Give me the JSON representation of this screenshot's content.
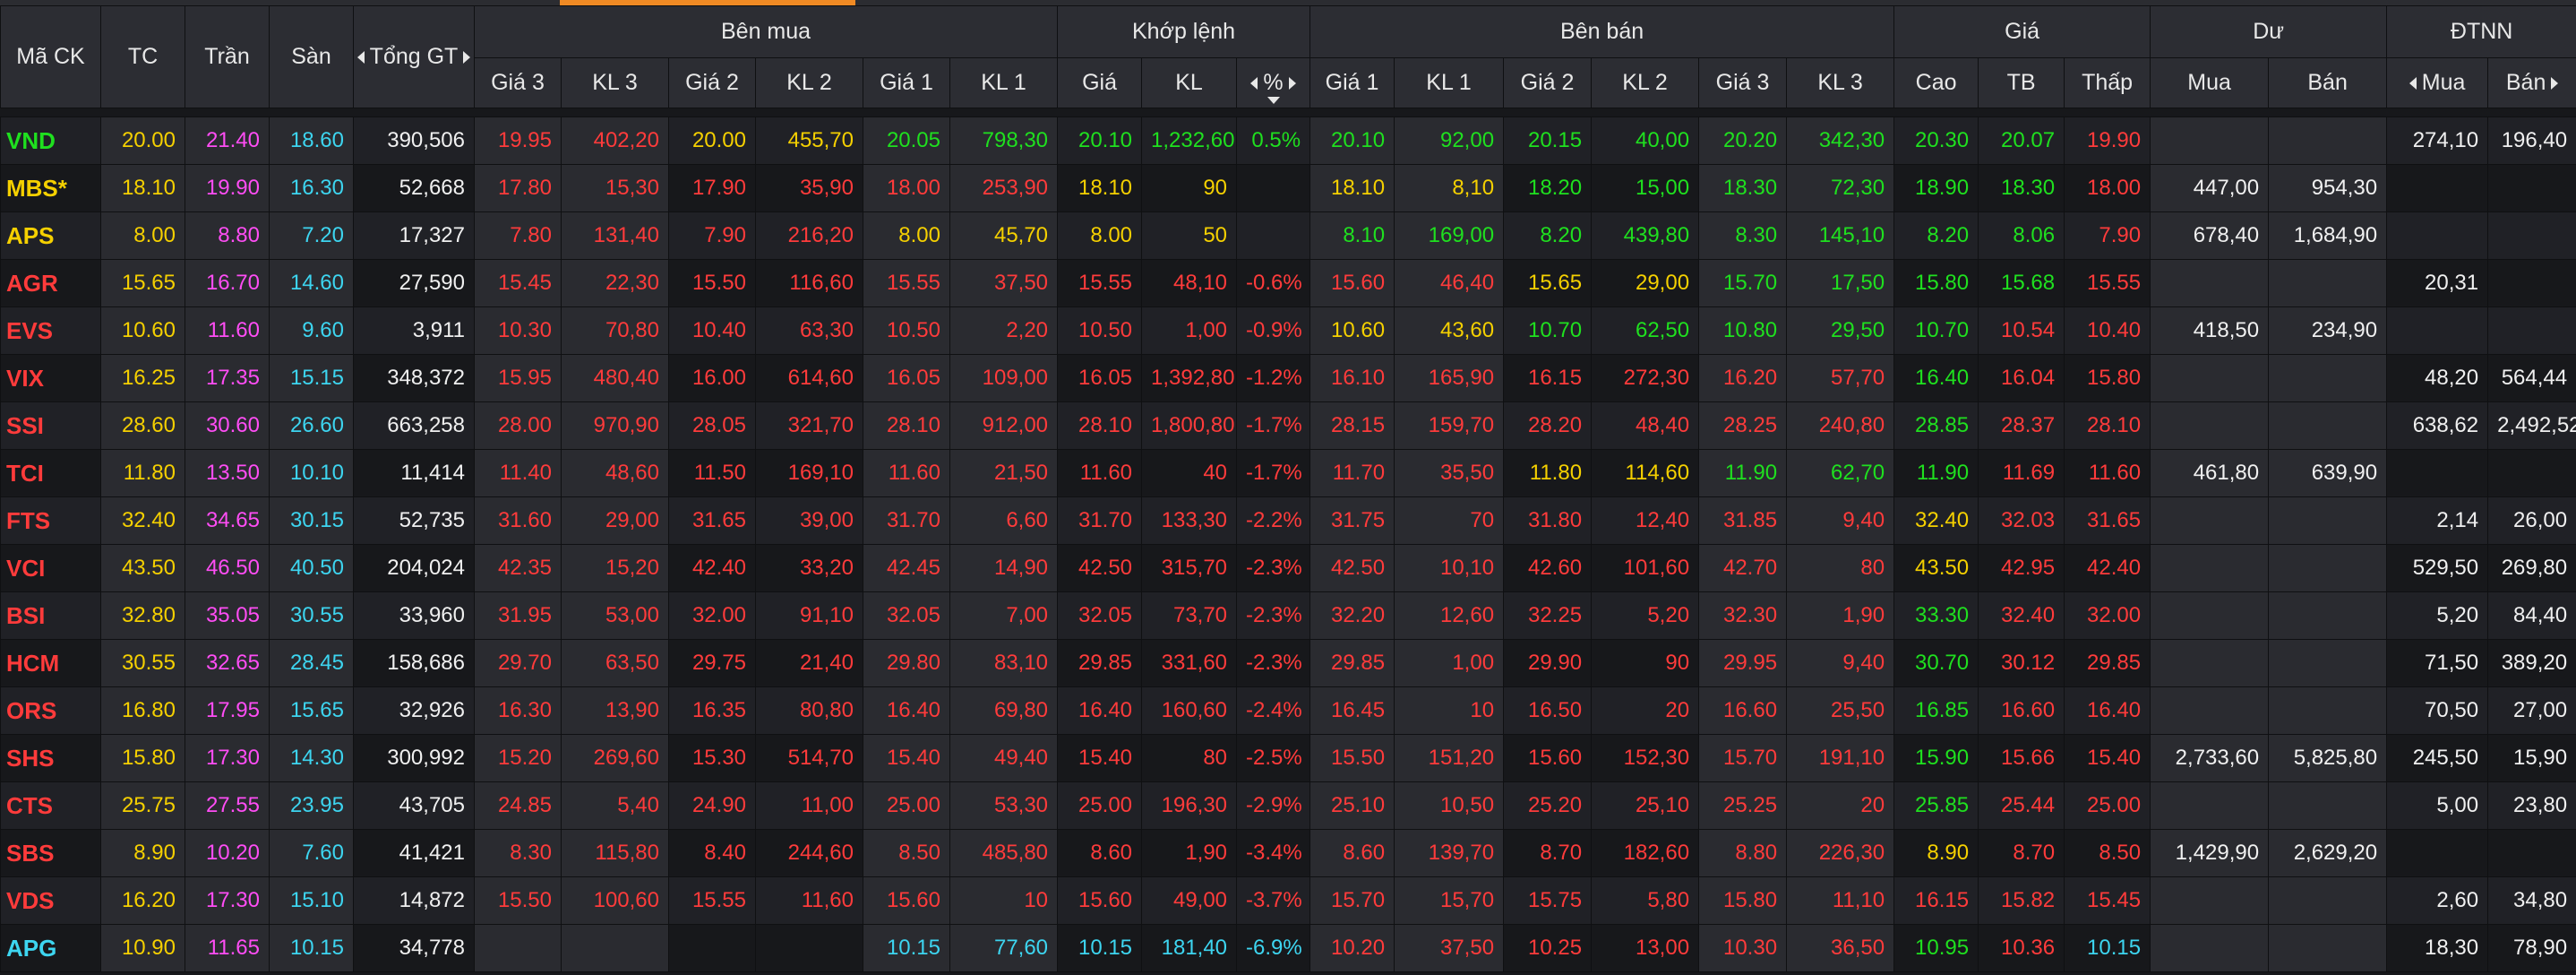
{
  "header": {
    "symbol": "Mã CK",
    "ref": "TC",
    "ceil": "Trần",
    "floor": "Sàn",
    "total": "Tổng GT",
    "groups": {
      "buy": "Bên mua",
      "match": "Khớp lệnh",
      "sell": "Bên bán",
      "price": "Giá",
      "remain": "Dư",
      "foreign": "ĐTNN"
    },
    "buy_cols": [
      "Giá 3",
      "KL 3",
      "Giá 2",
      "KL 2",
      "Giá 1",
      "KL 1"
    ],
    "match_cols": [
      "Giá",
      "KL",
      "%"
    ],
    "sell_cols": [
      "Giá 1",
      "KL 1",
      "Giá 2",
      "KL 2",
      "Giá 3",
      "KL 3"
    ],
    "price_cols": [
      "Cao",
      "TB",
      "Thấp"
    ],
    "remain_cols": [
      "Mua",
      "Bán"
    ],
    "foreign_cols": [
      "Mua",
      "Bán"
    ]
  },
  "colors": {
    "reference": "#f5d000",
    "ceiling": "#ff4df5",
    "floor": "#3dd5f0",
    "up": "#1fe01f",
    "down": "#ff3b3b",
    "neutral": "#f0f0f0"
  },
  "rows": [
    {
      "sym": "VND",
      "tc": "20.00",
      "tran": "21.40",
      "san": "18.60",
      "tong": "390,506",
      "g3": "19.95",
      "kl3": "402,20",
      "g2": "20.00",
      "kl2": "455,70",
      "g1": "20.05",
      "kl1": "798,30",
      "mg": "20.10",
      "mkl": "1,232,60",
      "pct": "0.5%",
      "sg1": "20.10",
      "skl1": "92,00",
      "sg2": "20.15",
      "skl2": "40,00",
      "sg3": "20.20",
      "skl3": "342,30",
      "cao": "20.30",
      "tb": "20.07",
      "thap": "19.90",
      "dmua": "",
      "dban": "",
      "nmua": "274,10",
      "nban": "196,40"
    },
    {
      "sym": "MBS*",
      "tc": "18.10",
      "tran": "19.90",
      "san": "16.30",
      "tong": "52,668",
      "g3": "17.80",
      "kl3": "15,30",
      "g2": "17.90",
      "kl2": "35,90",
      "g1": "18.00",
      "kl1": "253,90",
      "mg": "18.10",
      "mkl": "90",
      "pct": "",
      "sg1": "18.10",
      "skl1": "8,10",
      "sg2": "18.20",
      "skl2": "15,00",
      "sg3": "18.30",
      "skl3": "72,30",
      "cao": "18.90",
      "tb": "18.30",
      "thap": "18.00",
      "dmua": "447,00",
      "dban": "954,30",
      "nmua": "",
      "nban": ""
    },
    {
      "sym": "APS",
      "tc": "8.00",
      "tran": "8.80",
      "san": "7.20",
      "tong": "17,327",
      "g3": "7.80",
      "kl3": "131,40",
      "g2": "7.90",
      "kl2": "216,20",
      "g1": "8.00",
      "kl1": "45,70",
      "mg": "8.00",
      "mkl": "50",
      "pct": "",
      "sg1": "8.10",
      "skl1": "169,00",
      "sg2": "8.20",
      "skl2": "439,80",
      "sg3": "8.30",
      "skl3": "145,10",
      "cao": "8.20",
      "tb": "8.06",
      "thap": "7.90",
      "dmua": "678,40",
      "dban": "1,684,90",
      "nmua": "",
      "nban": ""
    },
    {
      "sym": "AGR",
      "tc": "15.65",
      "tran": "16.70",
      "san": "14.60",
      "tong": "27,590",
      "g3": "15.45",
      "kl3": "22,30",
      "g2": "15.50",
      "kl2": "116,60",
      "g1": "15.55",
      "kl1": "37,50",
      "mg": "15.55",
      "mkl": "48,10",
      "pct": "-0.6%",
      "sg1": "15.60",
      "skl1": "46,40",
      "sg2": "15.65",
      "skl2": "29,00",
      "sg3": "15.70",
      "skl3": "17,50",
      "cao": "15.80",
      "tb": "15.68",
      "thap": "15.55",
      "dmua": "",
      "dban": "",
      "nmua": "20,31",
      "nban": ""
    },
    {
      "sym": "EVS",
      "tc": "10.60",
      "tran": "11.60",
      "san": "9.60",
      "tong": "3,911",
      "g3": "10.30",
      "kl3": "70,80",
      "g2": "10.40",
      "kl2": "63,30",
      "g1": "10.50",
      "kl1": "2,20",
      "mg": "10.50",
      "mkl": "1,00",
      "pct": "-0.9%",
      "sg1": "10.60",
      "skl1": "43,60",
      "sg2": "10.70",
      "skl2": "62,50",
      "sg3": "10.80",
      "skl3": "29,50",
      "cao": "10.70",
      "tb": "10.54",
      "thap": "10.40",
      "dmua": "418,50",
      "dban": "234,90",
      "nmua": "",
      "nban": ""
    },
    {
      "sym": "VIX",
      "tc": "16.25",
      "tran": "17.35",
      "san": "15.15",
      "tong": "348,372",
      "g3": "15.95",
      "kl3": "480,40",
      "g2": "16.00",
      "kl2": "614,60",
      "g1": "16.05",
      "kl1": "109,00",
      "mg": "16.05",
      "mkl": "1,392,80",
      "pct": "-1.2%",
      "sg1": "16.10",
      "skl1": "165,90",
      "sg2": "16.15",
      "skl2": "272,30",
      "sg3": "16.20",
      "skl3": "57,70",
      "cao": "16.40",
      "tb": "16.04",
      "thap": "15.80",
      "dmua": "",
      "dban": "",
      "nmua": "48,20",
      "nban": "564,44"
    },
    {
      "sym": "SSI",
      "tc": "28.60",
      "tran": "30.60",
      "san": "26.60",
      "tong": "663,258",
      "g3": "28.00",
      "kl3": "970,90",
      "g2": "28.05",
      "kl2": "321,70",
      "g1": "28.10",
      "kl1": "912,00",
      "mg": "28.10",
      "mkl": "1,800,80",
      "pct": "-1.7%",
      "sg1": "28.15",
      "skl1": "159,70",
      "sg2": "28.20",
      "skl2": "48,40",
      "sg3": "28.25",
      "skl3": "240,80",
      "cao": "28.85",
      "tb": "28.37",
      "thap": "28.10",
      "dmua": "",
      "dban": "",
      "nmua": "638,62",
      "nban": "2,492,52"
    },
    {
      "sym": "TCI",
      "tc": "11.80",
      "tran": "13.50",
      "san": "10.10",
      "tong": "11,414",
      "g3": "11.40",
      "kl3": "48,60",
      "g2": "11.50",
      "kl2": "169,10",
      "g1": "11.60",
      "kl1": "21,50",
      "mg": "11.60",
      "mkl": "40",
      "pct": "-1.7%",
      "sg1": "11.70",
      "skl1": "35,50",
      "sg2": "11.80",
      "skl2": "114,60",
      "sg3": "11.90",
      "skl3": "62,70",
      "cao": "11.90",
      "tb": "11.69",
      "thap": "11.60",
      "dmua": "461,80",
      "dban": "639,90",
      "nmua": "",
      "nban": ""
    },
    {
      "sym": "FTS",
      "tc": "32.40",
      "tran": "34.65",
      "san": "30.15",
      "tong": "52,735",
      "g3": "31.60",
      "kl3": "29,00",
      "g2": "31.65",
      "kl2": "39,00",
      "g1": "31.70",
      "kl1": "6,60",
      "mg": "31.70",
      "mkl": "133,30",
      "pct": "-2.2%",
      "sg1": "31.75",
      "skl1": "70",
      "sg2": "31.80",
      "skl2": "12,40",
      "sg3": "31.85",
      "skl3": "9,40",
      "cao": "32.40",
      "tb": "32.03",
      "thap": "31.65",
      "dmua": "",
      "dban": "",
      "nmua": "2,14",
      "nban": "26,00"
    },
    {
      "sym": "VCI",
      "tc": "43.50",
      "tran": "46.50",
      "san": "40.50",
      "tong": "204,024",
      "g3": "42.35",
      "kl3": "15,20",
      "g2": "42.40",
      "kl2": "33,20",
      "g1": "42.45",
      "kl1": "14,90",
      "mg": "42.50",
      "mkl": "315,70",
      "pct": "-2.3%",
      "sg1": "42.50",
      "skl1": "10,10",
      "sg2": "42.60",
      "skl2": "101,60",
      "sg3": "42.70",
      "skl3": "80",
      "cao": "43.50",
      "tb": "42.95",
      "thap": "42.40",
      "dmua": "",
      "dban": "",
      "nmua": "529,50",
      "nban": "269,80"
    },
    {
      "sym": "BSI",
      "tc": "32.80",
      "tran": "35.05",
      "san": "30.55",
      "tong": "33,960",
      "g3": "31.95",
      "kl3": "53,00",
      "g2": "32.00",
      "kl2": "91,10",
      "g1": "32.05",
      "kl1": "7,00",
      "mg": "32.05",
      "mkl": "73,70",
      "pct": "-2.3%",
      "sg1": "32.20",
      "skl1": "12,60",
      "sg2": "32.25",
      "skl2": "5,20",
      "sg3": "32.30",
      "skl3": "1,90",
      "cao": "33.30",
      "tb": "32.40",
      "thap": "32.00",
      "dmua": "",
      "dban": "",
      "nmua": "5,20",
      "nban": "84,40"
    },
    {
      "sym": "HCM",
      "tc": "30.55",
      "tran": "32.65",
      "san": "28.45",
      "tong": "158,686",
      "g3": "29.70",
      "kl3": "63,50",
      "g2": "29.75",
      "kl2": "21,40",
      "g1": "29.80",
      "kl1": "83,10",
      "mg": "29.85",
      "mkl": "331,60",
      "pct": "-2.3%",
      "sg1": "29.85",
      "skl1": "1,00",
      "sg2": "29.90",
      "skl2": "90",
      "sg3": "29.95",
      "skl3": "9,40",
      "cao": "30.70",
      "tb": "30.12",
      "thap": "29.85",
      "dmua": "",
      "dban": "",
      "nmua": "71,50",
      "nban": "389,20"
    },
    {
      "sym": "ORS",
      "tc": "16.80",
      "tran": "17.95",
      "san": "15.65",
      "tong": "32,926",
      "g3": "16.30",
      "kl3": "13,90",
      "g2": "16.35",
      "kl2": "80,80",
      "g1": "16.40",
      "kl1": "69,80",
      "mg": "16.40",
      "mkl": "160,60",
      "pct": "-2.4%",
      "sg1": "16.45",
      "skl1": "10",
      "sg2": "16.50",
      "skl2": "20",
      "sg3": "16.60",
      "skl3": "25,50",
      "cao": "16.85",
      "tb": "16.60",
      "thap": "16.40",
      "dmua": "",
      "dban": "",
      "nmua": "70,50",
      "nban": "27,00"
    },
    {
      "sym": "SHS",
      "tc": "15.80",
      "tran": "17.30",
      "san": "14.30",
      "tong": "300,992",
      "g3": "15.20",
      "kl3": "269,60",
      "g2": "15.30",
      "kl2": "514,70",
      "g1": "15.40",
      "kl1": "49,40",
      "mg": "15.40",
      "mkl": "80",
      "pct": "-2.5%",
      "sg1": "15.50",
      "skl1": "151,20",
      "sg2": "15.60",
      "skl2": "152,30",
      "sg3": "15.70",
      "skl3": "191,10",
      "cao": "15.90",
      "tb": "15.66",
      "thap": "15.40",
      "dmua": "2,733,60",
      "dban": "5,825,80",
      "nmua": "245,50",
      "nban": "15,90"
    },
    {
      "sym": "CTS",
      "tc": "25.75",
      "tran": "27.55",
      "san": "23.95",
      "tong": "43,705",
      "g3": "24.85",
      "kl3": "5,40",
      "g2": "24.90",
      "kl2": "11,00",
      "g1": "25.00",
      "kl1": "53,30",
      "mg": "25.00",
      "mkl": "196,30",
      "pct": "-2.9%",
      "sg1": "25.10",
      "skl1": "10,50",
      "sg2": "25.20",
      "skl2": "25,10",
      "sg3": "25.25",
      "skl3": "20",
      "cao": "25.85",
      "tb": "25.44",
      "thap": "25.00",
      "dmua": "",
      "dban": "",
      "nmua": "5,00",
      "nban": "23,80"
    },
    {
      "sym": "SBS",
      "tc": "8.90",
      "tran": "10.20",
      "san": "7.60",
      "tong": "41,421",
      "g3": "8.30",
      "kl3": "115,80",
      "g2": "8.40",
      "kl2": "244,60",
      "g1": "8.50",
      "kl1": "485,80",
      "mg": "8.60",
      "mkl": "1,90",
      "pct": "-3.4%",
      "sg1": "8.60",
      "skl1": "139,70",
      "sg2": "8.70",
      "skl2": "182,60",
      "sg3": "8.80",
      "skl3": "226,30",
      "cao": "8.90",
      "tb": "8.70",
      "thap": "8.50",
      "dmua": "1,429,90",
      "dban": "2,629,20",
      "nmua": "",
      "nban": ""
    },
    {
      "sym": "VDS",
      "tc": "16.20",
      "tran": "17.30",
      "san": "15.10",
      "tong": "14,872",
      "g3": "15.50",
      "kl3": "100,60",
      "g2": "15.55",
      "kl2": "11,60",
      "g1": "15.60",
      "kl1": "10",
      "mg": "15.60",
      "mkl": "49,00",
      "pct": "-3.7%",
      "sg1": "15.70",
      "skl1": "15,70",
      "sg2": "15.75",
      "skl2": "5,80",
      "sg3": "15.80",
      "skl3": "11,10",
      "cao": "16.15",
      "tb": "15.82",
      "thap": "15.45",
      "dmua": "",
      "dban": "",
      "nmua": "2,60",
      "nban": "34,80"
    },
    {
      "sym": "APG",
      "tc": "10.90",
      "tran": "11.65",
      "san": "10.15",
      "tong": "34,778",
      "g3": "",
      "kl3": "",
      "g2": "",
      "kl2": "",
      "g1": "10.15",
      "kl1": "77,60",
      "mg": "10.15",
      "mkl": "181,40",
      "pct": "-6.9%",
      "sg1": "10.20",
      "skl1": "37,50",
      "sg2": "10.25",
      "skl2": "13,00",
      "sg3": "10.30",
      "skl3": "36,50",
      "cao": "10.95",
      "tb": "10.36",
      "thap": "10.15",
      "dmua": "",
      "dban": "",
      "nmua": "18,30",
      "nban": "78,90"
    }
  ]
}
